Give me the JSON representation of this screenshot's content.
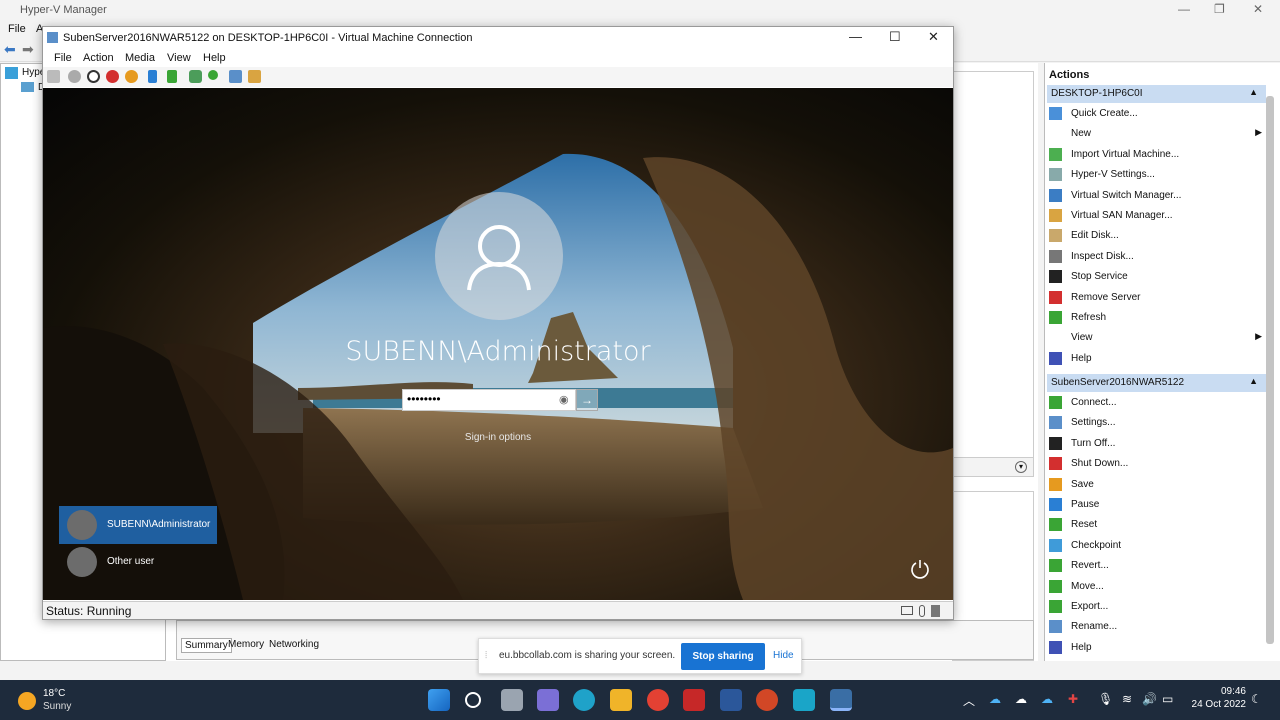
{
  "hyperv": {
    "title": "Hyper-V Manager",
    "menu": [
      "File",
      "A"
    ],
    "tree_root": "Hype",
    "tree_child": "D",
    "tabs": [
      "Summary",
      "Memory",
      "Networking"
    ]
  },
  "actions": {
    "header": "Actions",
    "group1": {
      "title": "DESKTOP-1HP6C0I",
      "items": [
        {
          "label": "Quick Create...",
          "icon": "quick-create-icon",
          "color": "#4a90d9"
        },
        {
          "label": "New",
          "icon": "new-icon",
          "color": "#ffffff",
          "submenu": true
        },
        {
          "label": "Import Virtual Machine...",
          "icon": "import-icon",
          "color": "#4caf50"
        },
        {
          "label": "Hyper-V Settings...",
          "icon": "settings-icon",
          "color": "#8aa"
        },
        {
          "label": "Virtual Switch Manager...",
          "icon": "switch-icon",
          "color": "#3b7dc4"
        },
        {
          "label": "Virtual SAN Manager...",
          "icon": "san-icon",
          "color": "#d9a441"
        },
        {
          "label": "Edit Disk...",
          "icon": "edit-disk-icon",
          "color": "#c9a86b"
        },
        {
          "label": "Inspect Disk...",
          "icon": "inspect-disk-icon",
          "color": "#777"
        },
        {
          "label": "Stop Service",
          "icon": "stop-icon",
          "color": "#222"
        },
        {
          "label": "Remove Server",
          "icon": "remove-icon",
          "color": "#d32f2f"
        },
        {
          "label": "Refresh",
          "icon": "refresh-icon",
          "color": "#3aa535"
        },
        {
          "label": "View",
          "icon": "view-icon",
          "color": "#ffffff",
          "submenu": true
        },
        {
          "label": "Help",
          "icon": "help-icon",
          "color": "#3f51b5"
        }
      ]
    },
    "group2": {
      "title": "SubenServer2016NWAR5122",
      "items": [
        {
          "label": "Connect...",
          "icon": "connect-icon",
          "color": "#3aa535"
        },
        {
          "label": "Settings...",
          "icon": "settings-icon",
          "color": "#5b8fc9"
        },
        {
          "label": "Turn Off...",
          "icon": "turn-off-icon",
          "color": "#222"
        },
        {
          "label": "Shut Down...",
          "icon": "shut-down-icon",
          "color": "#d32f2f"
        },
        {
          "label": "Save",
          "icon": "save-icon",
          "color": "#e69a1f"
        },
        {
          "label": "Pause",
          "icon": "pause-icon",
          "color": "#2a7fd4"
        },
        {
          "label": "Reset",
          "icon": "reset-icon",
          "color": "#3aa535"
        },
        {
          "label": "Checkpoint",
          "icon": "checkpoint-icon",
          "color": "#3f9bd9"
        },
        {
          "label": "Revert...",
          "icon": "revert-icon",
          "color": "#3aa535"
        },
        {
          "label": "Move...",
          "icon": "move-icon",
          "color": "#3aa535"
        },
        {
          "label": "Export...",
          "icon": "export-icon",
          "color": "#3aa535"
        },
        {
          "label": "Rename...",
          "icon": "rename-icon",
          "color": "#5b8fc9"
        },
        {
          "label": "Help",
          "icon": "help-icon",
          "color": "#3f51b5"
        }
      ]
    }
  },
  "vm": {
    "title": "SubenServer2016NWAR5122 on DESKTOP-1HP6C0I - Virtual Machine Connection",
    "menu": [
      "File",
      "Action",
      "Media",
      "View",
      "Help"
    ],
    "status": "Status: Running",
    "login": {
      "user": "SUBENN\\Administrator",
      "password_mask": "••••••••",
      "signin_options": "Sign-in options",
      "tiles": [
        "SUBENN\\Administrator",
        "Other user"
      ]
    }
  },
  "share": {
    "message": "eu.bbcollab.com is sharing your screen.",
    "stop": "Stop sharing",
    "hide": "Hide"
  },
  "taskbar": {
    "temp": "18°C",
    "condition": "Sunny",
    "time": "09:46",
    "date": "24 Oct 2022"
  }
}
